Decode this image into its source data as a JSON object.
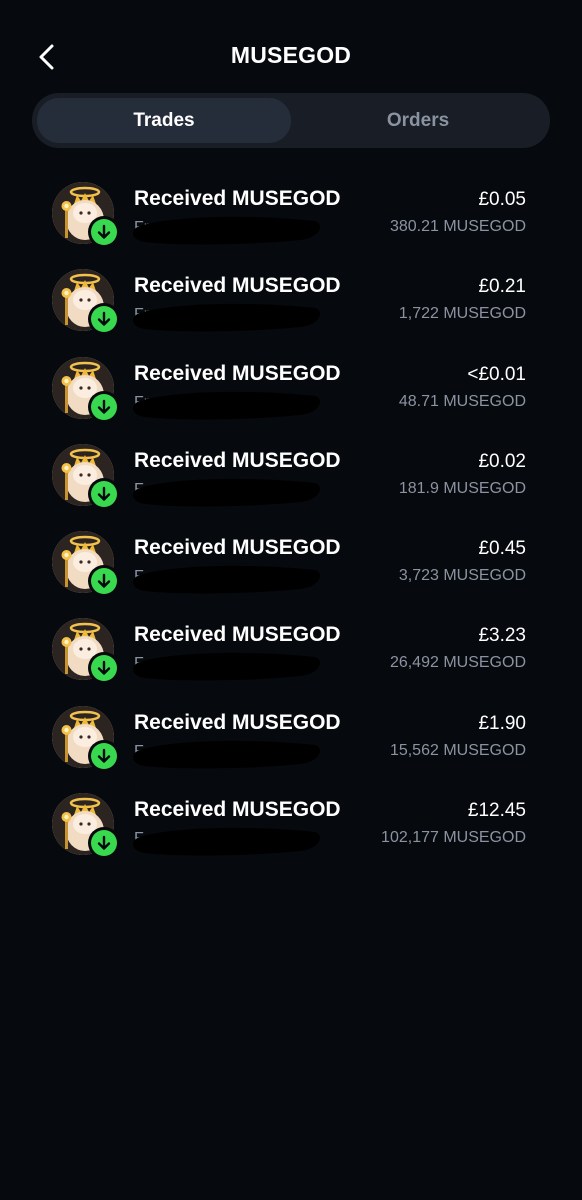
{
  "header": {
    "title": "MUSEGOD",
    "back_icon": "chevron-left-icon"
  },
  "tabs": [
    {
      "label": "Trades",
      "active": true
    },
    {
      "label": "Orders",
      "active": false
    }
  ],
  "transactions": [
    {
      "title": "Received MUSEGOD",
      "subtitle": "From",
      "amount": "£0.05",
      "quantity": "380.21 MUSEGOD"
    },
    {
      "title": "Received MUSEGOD",
      "subtitle": "From",
      "amount": "£0.21",
      "quantity": "1,722 MUSEGOD"
    },
    {
      "title": "Received MUSEGOD",
      "subtitle": "Fr",
      "amount": "<£0.01",
      "quantity": "48.71 MUSEGOD"
    },
    {
      "title": "Received MUSEGOD",
      "subtitle": "F",
      "amount": "£0.02",
      "quantity": "181.9 MUSEGOD"
    },
    {
      "title": "Received MUSEGOD",
      "subtitle": "F",
      "amount": "£0.45",
      "quantity": "3,723 MUSEGOD"
    },
    {
      "title": "Received MUSEGOD",
      "subtitle": "F",
      "amount": "£3.23",
      "quantity": "26,492 MUSEGOD"
    },
    {
      "title": "Received MUSEGOD",
      "subtitle": "F",
      "amount": "£1.90",
      "quantity": "15,562 MUSEGOD"
    },
    {
      "title": "Received MUSEGOD",
      "subtitle": "F",
      "amount": "£12.45",
      "quantity": "102,177 MUSEGOD"
    }
  ],
  "icons": {
    "avatar": "musegod-token-icon",
    "badge": "arrow-down-circle-icon"
  },
  "colors": {
    "background": "#06090d",
    "tab_track": "#181d26",
    "tab_active": "#262d3a",
    "badge_green": "#39d94f",
    "muted_text": "#8b93a1"
  }
}
